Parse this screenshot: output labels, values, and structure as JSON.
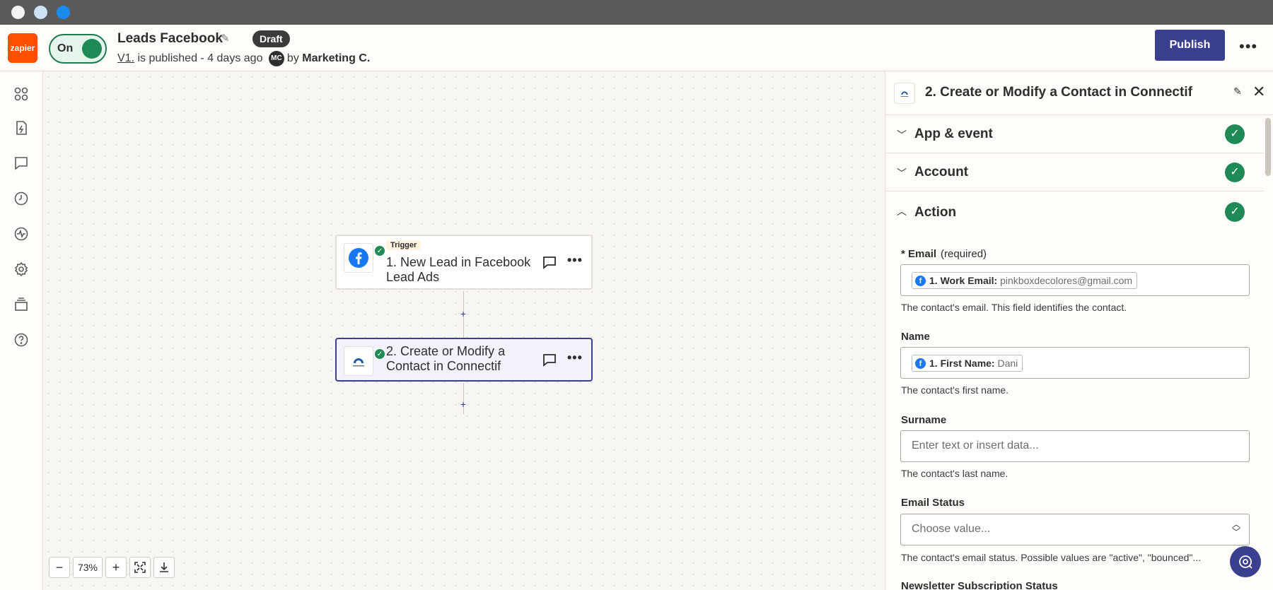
{
  "header": {
    "logo_text": "zapier",
    "toggle_label": "On",
    "zap_title": "Leads Facebook",
    "draft_badge": "Draft",
    "version_link": "V1.",
    "published_text": "is published - 4 days ago",
    "avatar_initials": "MC",
    "by_text": "by",
    "author": "Marketing C.",
    "publish_label": "Publish",
    "more_label": "•••"
  },
  "sidebar": {
    "icons": [
      "apps-icon",
      "file-bolt-icon",
      "comment-icon",
      "history-icon",
      "activity-icon",
      "settings-icon",
      "layers-icon",
      "help-icon"
    ]
  },
  "canvas": {
    "steps": [
      {
        "tag": "Trigger",
        "title": "1. New Lead in Facebook Lead Ads",
        "app": "facebook"
      },
      {
        "tag": "",
        "title": "2. Create or Modify a Contact in Connectif",
        "app": "connectif"
      }
    ],
    "plus_label": "+",
    "zoom": {
      "minus_label": "−",
      "level": "73%",
      "plus_label": "+"
    }
  },
  "panel": {
    "title": "2. Create or Modify a Contact in Connectif",
    "sections": [
      {
        "label": "App & event",
        "expanded": false,
        "complete": true
      },
      {
        "label": "Account",
        "expanded": false,
        "complete": true
      },
      {
        "label": "Action",
        "expanded": true,
        "complete": true
      }
    ],
    "fields": {
      "email": {
        "label": "* Email",
        "required_note": "(required)",
        "pill_key": "1. Work Email:",
        "pill_value": "pinkboxdecolores@gmail.com",
        "help": "The contact's email. This field identifies the contact."
      },
      "name": {
        "label": "Name",
        "pill_key": "1. First Name:",
        "pill_value": "Dani",
        "help": "The contact's first name."
      },
      "surname": {
        "label": "Surname",
        "placeholder": "Enter text or insert data...",
        "help": "The contact's last name."
      },
      "email_status": {
        "label": "Email Status",
        "value": "Choose value...",
        "help": "The contact's email status. Possible values are \"active\", \"bounced\"..."
      },
      "newsletter": {
        "label": "Newsletter Subscription Status"
      }
    }
  },
  "colors": {
    "brand": "#ff4f00",
    "accent": "#3b3f8f",
    "success": "#1f8a55",
    "facebook": "#1877f2"
  }
}
